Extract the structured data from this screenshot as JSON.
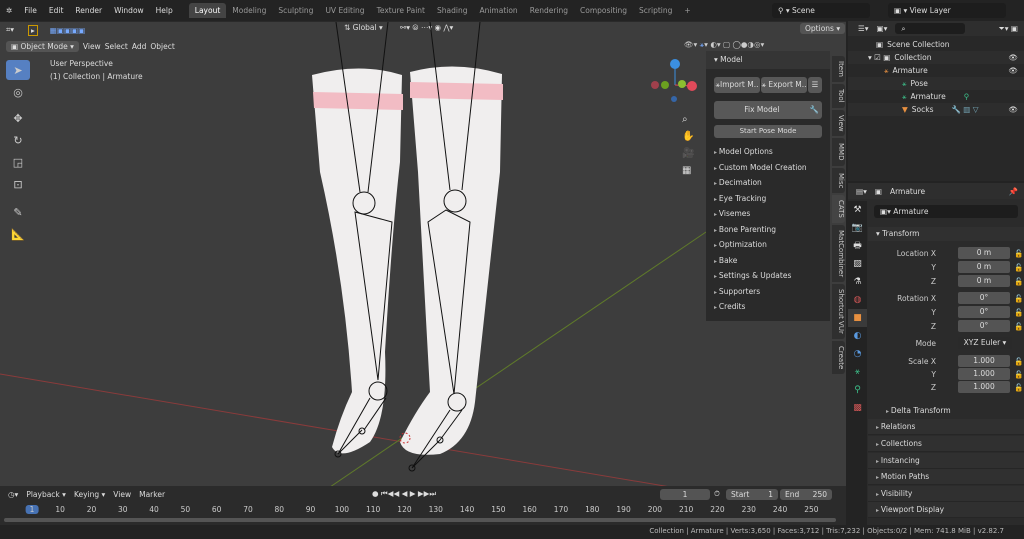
{
  "topbar": {
    "menus": [
      "File",
      "Edit",
      "Render",
      "Window",
      "Help"
    ],
    "workspaces": [
      "Layout",
      "Modeling",
      "Sculpting",
      "UV Editing",
      "Texture Paint",
      "Shading",
      "Animation",
      "Rendering",
      "Compositing",
      "Scripting"
    ],
    "plus": "+",
    "scene": "Scene",
    "view_layer": "View Layer"
  },
  "viewport": {
    "mode": "Object Mode",
    "menus": [
      "View",
      "Select",
      "Add",
      "Object"
    ],
    "orientation": "Global",
    "options": "Options",
    "overlay_text": "User Perspective",
    "overlay_sub": "(1) Collection | Armature"
  },
  "npanel": {
    "header": "Model",
    "import": "Import M..",
    "export": "Export M..",
    "fix": "Fix Model",
    "pose": "Start Pose Mode",
    "items": [
      "Model Options",
      "Custom Model Creation",
      "Decimation",
      "Eye Tracking",
      "Visemes",
      "Bone Parenting",
      "Optimization",
      "Bake",
      "Settings & Updates",
      "Supporters",
      "Credits"
    ],
    "tabs": [
      "Item",
      "Tool",
      "View",
      "MMD",
      "Misc",
      "CATS",
      "MatCombiner",
      "Shortcut VUr",
      "Create"
    ]
  },
  "outliner": {
    "rows": [
      "Scene Collection",
      "Collection",
      "Armature",
      "Pose",
      "Armature",
      "Socks"
    ]
  },
  "properties": {
    "object": "Armature",
    "name": "Armature",
    "transform": "Transform",
    "location_label": "Location X",
    "rotation_label": "Rotation X",
    "scale_label": "Scale X",
    "y": "Y",
    "z": "Z",
    "location": [
      "0 m",
      "0 m",
      "0 m"
    ],
    "rotation": [
      "0°",
      "0°",
      "0°"
    ],
    "mode_label": "Mode",
    "mode": "XYZ Euler",
    "scale": [
      "1.000",
      "1.000",
      "1.000"
    ],
    "delta": "Delta Transform",
    "sections": [
      "Relations",
      "Collections",
      "Instancing",
      "Motion Paths",
      "Visibility",
      "Viewport Display"
    ]
  },
  "timeline": {
    "menus": [
      "Playback",
      "Keying",
      "View",
      "Marker"
    ],
    "current": "1",
    "start_label": "Start",
    "start": "1",
    "end_label": "End",
    "end": "250",
    "ticks": [
      "1",
      "10",
      "20",
      "30",
      "40",
      "50",
      "60",
      "70",
      "80",
      "90",
      "100",
      "110",
      "120",
      "130",
      "140",
      "150",
      "160",
      "170",
      "180",
      "190",
      "200",
      "210",
      "220",
      "230",
      "240",
      "250"
    ]
  },
  "status": "Collection | Armature | Verts:3,650 | Faces:3,712 | Tris:7,232 | Objects:0/2 | Mem: 741.8 MiB | v2.82.7"
}
